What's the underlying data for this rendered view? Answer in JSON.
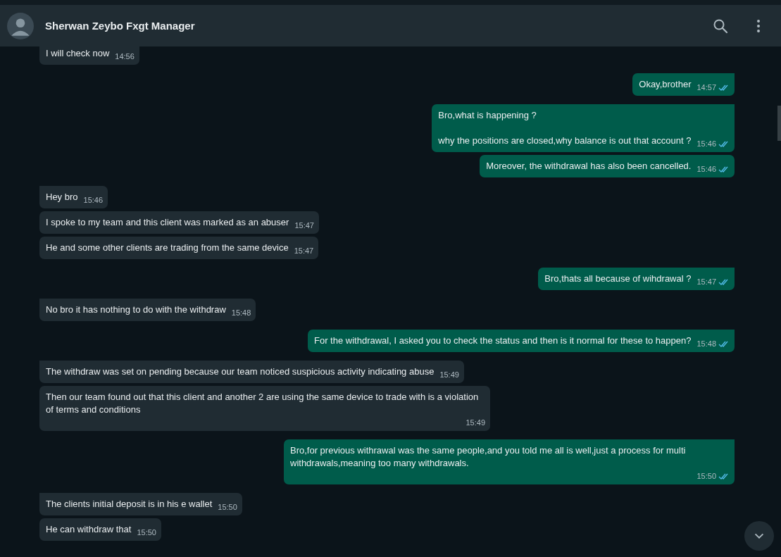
{
  "header": {
    "contact_name": "Sherwan Zeybo Fxgt Manager"
  },
  "messages": [
    {
      "kind": "incoming",
      "tail": false,
      "text": "I will check now",
      "time": "14:56"
    },
    {
      "kind": "outgoing",
      "tail": true,
      "text": "Okay,brother",
      "time": "14:57",
      "read": true
    },
    {
      "kind": "outgoing",
      "tail": true,
      "text": "Bro,what is happening ?\n\nwhy the positions are closed,why balance is out that account ?",
      "time": "15:46",
      "read": true
    },
    {
      "kind": "outgoing",
      "tail": false,
      "text": "Moreover, the withdrawal has also been cancelled.",
      "time": "15:46",
      "read": true
    },
    {
      "kind": "incoming",
      "tail": true,
      "text": "Hey bro",
      "time": "15:46"
    },
    {
      "kind": "incoming",
      "tail": false,
      "text": "I spoke to my team and this client was marked as an abuser",
      "time": "15:47"
    },
    {
      "kind": "incoming",
      "tail": false,
      "text": "He and some other clients are trading from the same device",
      "time": "15:47"
    },
    {
      "kind": "outgoing",
      "tail": true,
      "text": "Bro,thats all because of wihdrawal ?",
      "time": "15:47",
      "read": true
    },
    {
      "kind": "incoming",
      "tail": true,
      "text": "No bro it has nothing to do with the withdraw",
      "time": "15:48"
    },
    {
      "kind": "outgoing",
      "tail": true,
      "text": "For the withdrawal, I asked you to check the status and then is it normal for these to happen?",
      "time": "15:48",
      "read": true
    },
    {
      "kind": "incoming",
      "tail": true,
      "text": "The withdraw was set on pending because our team noticed suspicious activity indicating abuse",
      "time": "15:49"
    },
    {
      "kind": "incoming",
      "tail": false,
      "text": "Then our team found out that this client and another 2 are using the same device to trade with is a violation of terms and conditions",
      "time": "15:49"
    },
    {
      "kind": "outgoing",
      "tail": true,
      "text": "Bro,for previous withrawal was the same people,and you told me all is well,just a process for multi withdrawals,meaning too many withdrawals.",
      "time": "15:50",
      "read": true
    },
    {
      "kind": "incoming",
      "tail": true,
      "text": "The clients initial deposit is in his e wallet",
      "time": "15:50"
    },
    {
      "kind": "incoming",
      "tail": false,
      "text": "He can withdraw that",
      "time": "15:50"
    }
  ]
}
